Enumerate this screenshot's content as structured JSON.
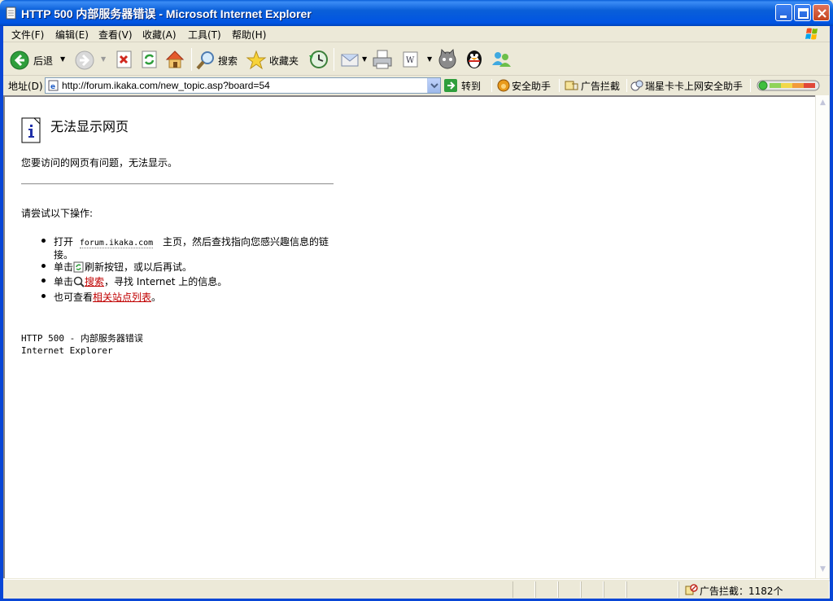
{
  "window": {
    "title": "HTTP 500 内部服务器错误 - Microsoft Internet Explorer",
    "frame_color": "#0054E3"
  },
  "menu": {
    "items": [
      "文件(F)",
      "编辑(E)",
      "查看(V)",
      "收藏(A)",
      "工具(T)",
      "帮助(H)"
    ]
  },
  "toolbar": {
    "back_label": "后退",
    "search_label": "搜索",
    "favorites_label": "收藏夹"
  },
  "address": {
    "label": "地址(D)",
    "url": "http://forum.ikaka.com/new_topic.asp?board=54",
    "go_label": "转到",
    "security_helper": "安全助手",
    "ad_block": "广告拦截",
    "rising_helper": "瑞星卡卡上网安全助手"
  },
  "page": {
    "heading": "无法显示网页",
    "message": "您要访问的网页有问题，无法显示。",
    "try_label": "请尝试以下操作:",
    "bullet1_prefix": "打开",
    "bullet1_link": "forum.ikaka.com",
    "bullet1_suffix": "主页，然后查找指向您感兴趣信息的链",
    "bullet1_cont": "接。",
    "bullet2_prefix": "单击",
    "bullet2_suffix": "刷新按钮，或以后再试。",
    "bullet3_prefix": "单击",
    "bullet3_link": "搜索",
    "bullet3_suffix": "，寻找 Internet 上的信息。",
    "bullet4_prefix": "也可查看",
    "bullet4_link": "相关站点列表",
    "bullet4_suffix": "。",
    "error_code": "HTTP 500 - 内部服务器错误",
    "error_source": "Internet Explorer",
    "link_color": "#C00000"
  },
  "status": {
    "ad_block_count": "广告拦截：1182个"
  }
}
